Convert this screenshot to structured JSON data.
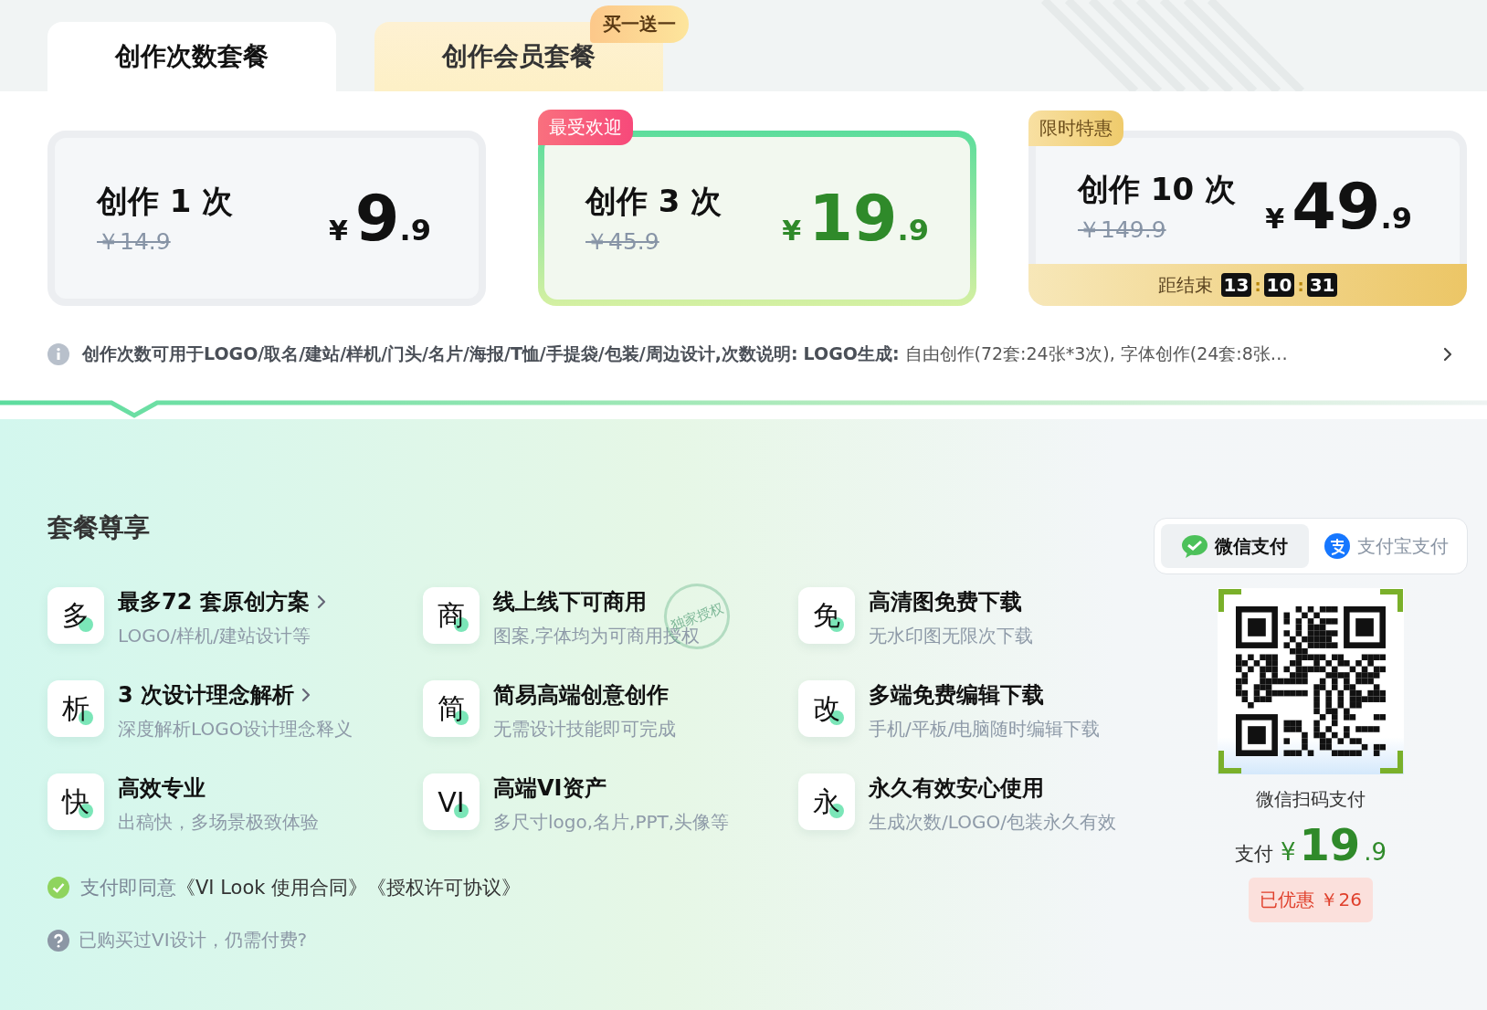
{
  "tabs": [
    {
      "label": "创作次数套餐",
      "selected": true
    },
    {
      "label": "创作会员套餐",
      "selected": false,
      "badge": "买一送一"
    }
  ],
  "plans": [
    {
      "name": "创作 1 次",
      "original_price": "￥14.9",
      "currency": "¥",
      "price_int": "9",
      "price_dec": ".9",
      "selected": false
    },
    {
      "name": "创作 3 次",
      "original_price": "￥45.9",
      "currency": "¥",
      "price_int": "19",
      "price_dec": ".9",
      "selected": true,
      "tag": {
        "text": "最受欢迎",
        "kind": "popular"
      }
    },
    {
      "name": "创作 10 次",
      "original_price": "￥149.9",
      "currency": "¥",
      "price_int": "49",
      "price_dec": ".9",
      "selected": false,
      "tag": {
        "text": "限时特惠",
        "kind": "limited"
      },
      "countdown": {
        "label": "距结束",
        "digits": [
          "13",
          "10",
          "31"
        ],
        "separators": [
          ":",
          ":"
        ]
      }
    }
  ],
  "info": "**创作次数可用于LOGO/取名/建站/样机/门头/名片/海报/T恤/手提袋/包装/周边设计,次数说明:**   **LOGO生成:** 自由创作(72套:24张*3次), 字体创作(24套:8张…",
  "benefits_title": "套餐尊享",
  "benefits": [
    {
      "icon": "多",
      "title": "最多72 套原创方案",
      "subtitle": "LOGO/样机/建站设计等",
      "link": true
    },
    {
      "icon": "商",
      "title": "线上线下可商用",
      "subtitle": "图案,字体均为可商用授权",
      "link": false,
      "stamp": "独家授权"
    },
    {
      "icon": "免",
      "title": "高清图免费下载",
      "subtitle": "无水印图无限次下载",
      "link": false
    },
    {
      "icon": "析",
      "title": "3 次设计理念解析",
      "subtitle": "深度解析LOGO设计理念释义",
      "link": true
    },
    {
      "icon": "简",
      "title": "简易高端创意创作",
      "subtitle": "无需设计技能即可完成",
      "link": false
    },
    {
      "icon": "改",
      "title": "多端免费编辑下载",
      "subtitle": "手机/平板/电脑随时编辑下载",
      "link": false
    },
    {
      "icon": "快",
      "title": "高效专业",
      "subtitle": "出稿快，多场景极致体验",
      "link": false
    },
    {
      "icon": "VI",
      "title": "高端VI资产",
      "subtitle": "多尺寸logo,名片,PPT,头像等",
      "link": false
    },
    {
      "icon": "永",
      "title": "永久有效安心使用",
      "subtitle": "生成次数/LOGO/包装永久有效",
      "link": false
    }
  ],
  "agreement": {
    "checked": true,
    "prefix": "支付即同意",
    "links": [
      "《VI Look 使用合同》",
      "《授权许可协议》"
    ]
  },
  "question": "已购买过VI设计，仍需付费?",
  "payment": {
    "methods": [
      {
        "label": "微信支付",
        "kind": "wechat",
        "selected": true
      },
      {
        "label": "支付宝支付",
        "kind": "alipay",
        "selected": false
      }
    ],
    "qr_caption": "微信扫码支付",
    "pay_label": "支付",
    "currency": "¥",
    "amount_int": "19",
    "amount_dec": ".9",
    "discount": "已优惠 ￥26"
  }
}
